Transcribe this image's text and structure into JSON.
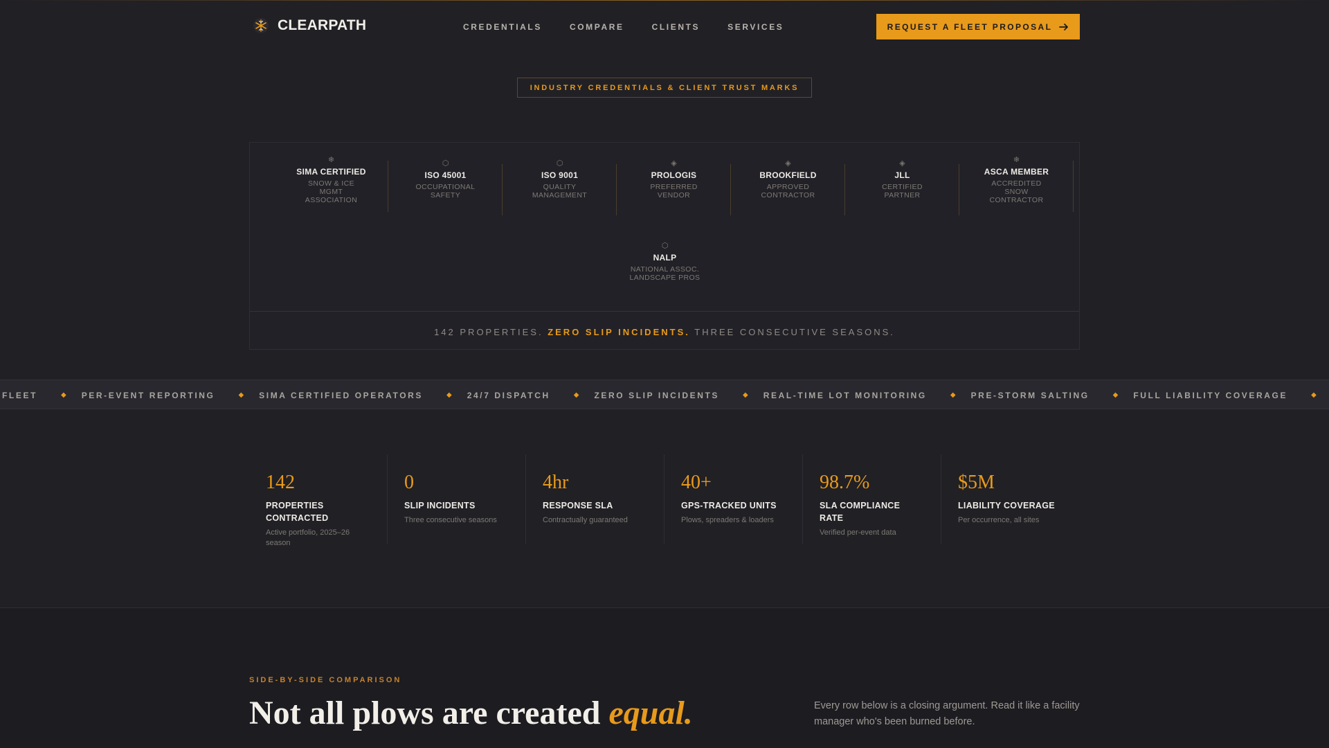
{
  "header": {
    "brand": "CLEARPATH",
    "nav": [
      "CREDENTIALS",
      "COMPARE",
      "CLIENTS",
      "SERVICES"
    ],
    "cta_label": "REQUEST A FLEET PROPOSAL"
  },
  "trust": {
    "eyebrow": "INDUSTRY CREDENTIALS & CLIENT TRUST MARKS",
    "credentials": [
      {
        "icon": "snowflake-icon",
        "glyph": "❄",
        "name": "SIMA CERTIFIED",
        "desc": [
          "SNOW & ICE",
          "MGMT",
          "ASSOCIATION"
        ]
      },
      {
        "icon": "hexagon-icon",
        "glyph": "⬡",
        "name": "ISO 45001",
        "desc": [
          "OCCUPATIONAL",
          "SAFETY"
        ]
      },
      {
        "icon": "hexagon-icon",
        "glyph": "⬡",
        "name": "ISO 9001",
        "desc": [
          "QUALITY",
          "MANAGEMENT"
        ]
      },
      {
        "icon": "diamond-icon",
        "glyph": "◈",
        "name": "PROLOGIS",
        "desc": [
          "PREFERRED",
          "VENDOR"
        ]
      },
      {
        "icon": "diamond-icon",
        "glyph": "◈",
        "name": "BROOKFIELD",
        "desc": [
          "APPROVED",
          "CONTRACTOR"
        ]
      },
      {
        "icon": "diamond-icon",
        "glyph": "◈",
        "name": "JLL",
        "desc": [
          "CERTIFIED",
          "PARTNER"
        ]
      },
      {
        "icon": "snowflake-icon",
        "glyph": "❄",
        "name": "ASCA MEMBER",
        "desc": [
          "ACCREDITED",
          "SNOW",
          "CONTRACTOR"
        ]
      },
      {
        "icon": "hexagon-icon",
        "glyph": "⬡",
        "name": "NALP",
        "desc": [
          "NATIONAL ASSOC.",
          "LANDSCAPE PROS"
        ]
      }
    ],
    "tagline_pre": "142 PROPERTIES.",
    "tagline_highlight": "ZERO SLIP INCIDENTS.",
    "tagline_post": "THREE CONSECUTIVE SEASONS."
  },
  "ticker": {
    "items": [
      "FLEET",
      "PER-EVENT REPORTING",
      "SIMA CERTIFIED OPERATORS",
      "24/7 DISPATCH",
      "ZERO SLIP INCIDENTS",
      "REAL-TIME LOT MONITORING",
      "PRE-STORM SALTING",
      "FULL LIABILITY COVERAGE"
    ],
    "separator": "◆"
  },
  "stats": [
    {
      "value": "142",
      "label": [
        "PROPERTIES",
        "CONTRACTED"
      ],
      "sub": [
        "Active portfolio, 2025–26",
        "season"
      ]
    },
    {
      "value": "0",
      "label": [
        "SLIP INCIDENTS"
      ],
      "sub": [
        "Three consecutive seasons"
      ]
    },
    {
      "value": "4hr",
      "label": [
        "RESPONSE SLA"
      ],
      "sub": [
        "Contractually guaranteed"
      ]
    },
    {
      "value": "40+",
      "label": [
        "GPS-TRACKED UNITS"
      ],
      "sub": [
        "Plows, spreaders & loaders"
      ]
    },
    {
      "value": "98.7%",
      "label": [
        "SLA COMPLIANCE",
        "RATE"
      ],
      "sub": [
        "Verified per-event data"
      ]
    },
    {
      "value": "$5M",
      "label": [
        "LIABILITY COVERAGE"
      ],
      "sub": [
        "Per occurrence, all sites"
      ]
    }
  ],
  "comparison": {
    "eyebrow": "SIDE-BY-SIDE COMPARISON",
    "title": "Not all plows are created",
    "title_accent": "equal.",
    "description": "Every row below is a closing argument. Read it like a facility manager who's been burned before."
  },
  "colors": {
    "background": "#212025",
    "accent": "#e89a1b",
    "text": "#eeebe5",
    "muted": "#7d7a74"
  }
}
